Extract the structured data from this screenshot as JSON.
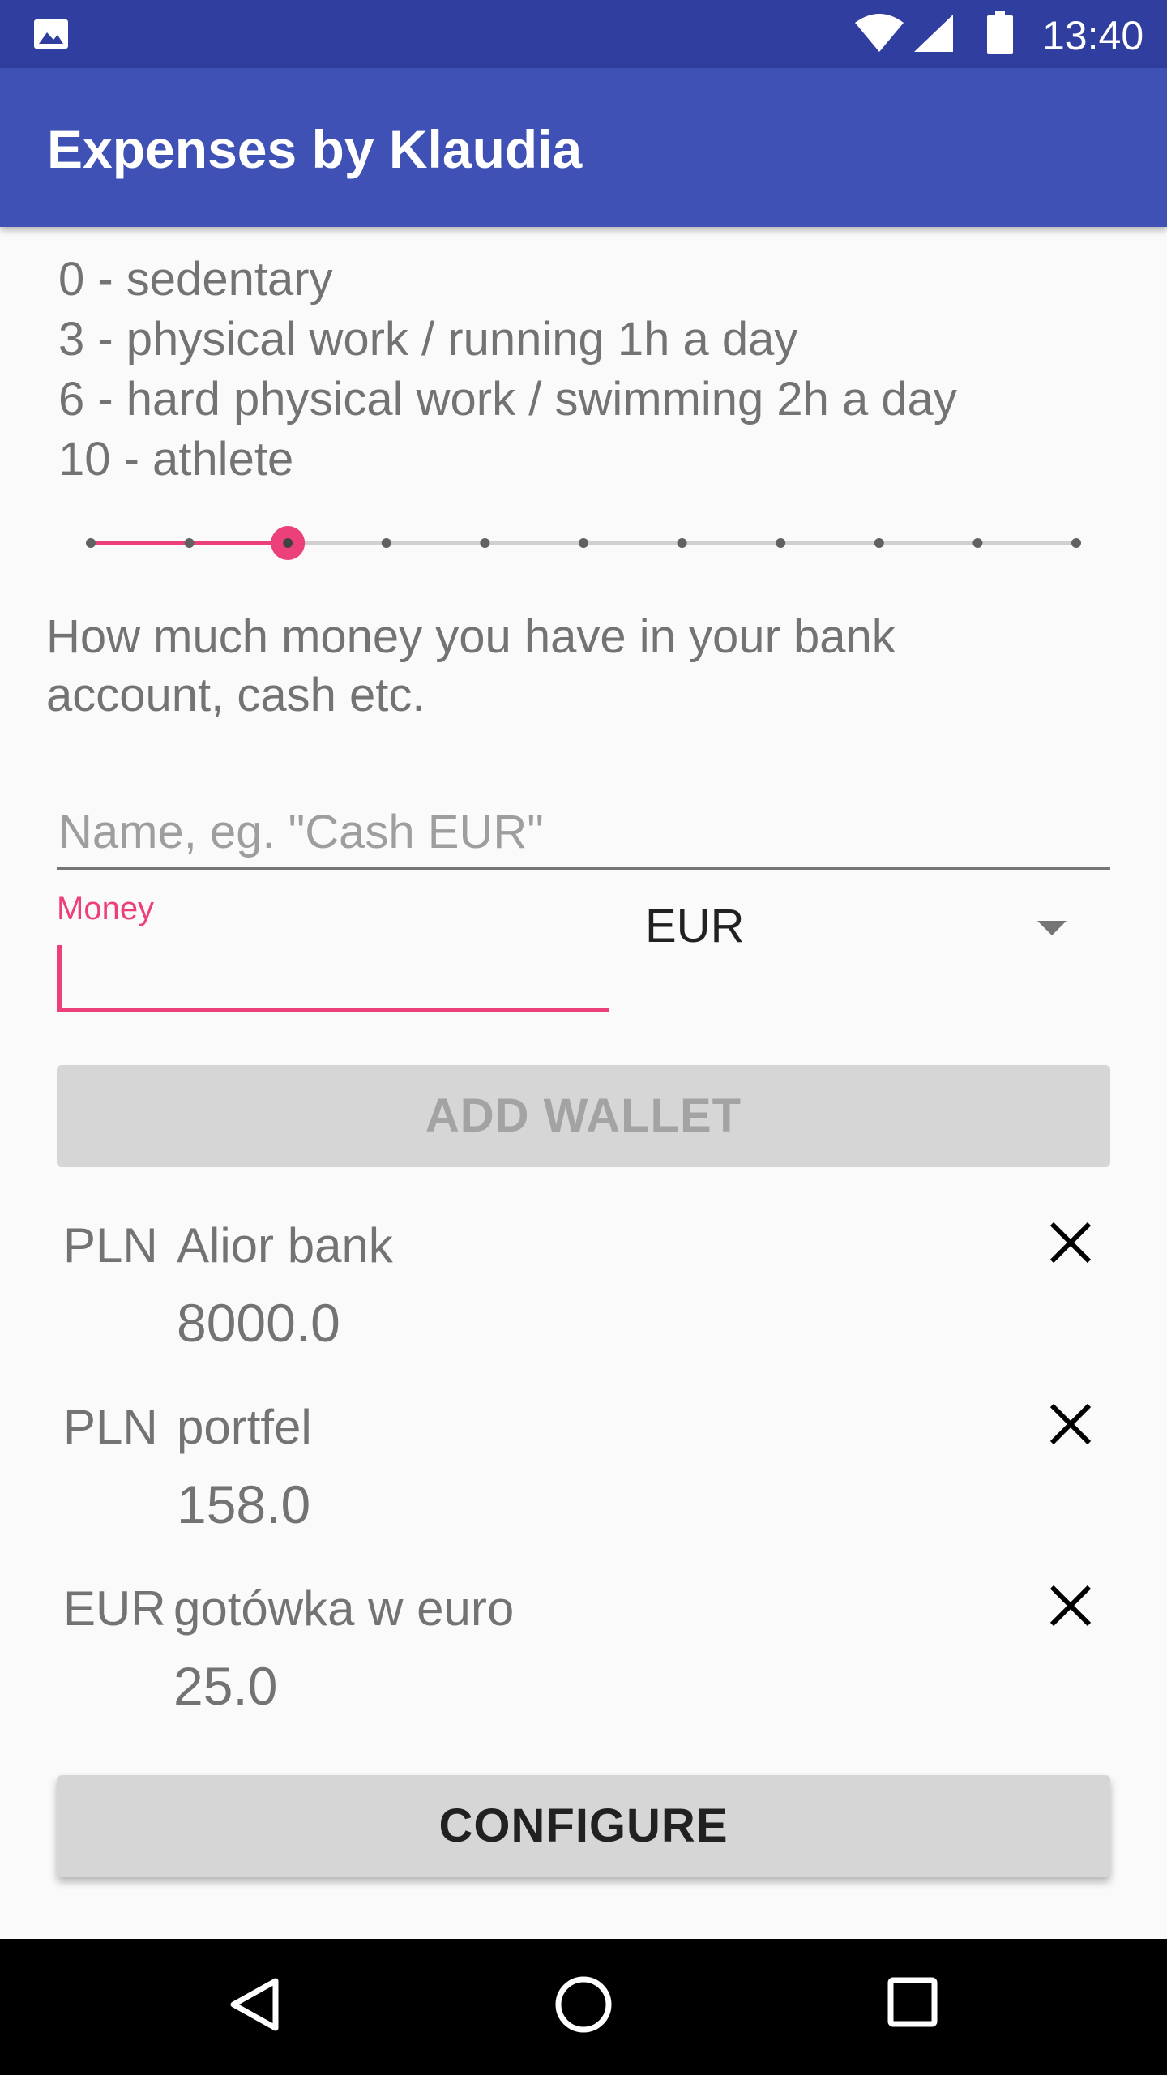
{
  "status_bar": {
    "time": "13:40",
    "icons": [
      "image-icon",
      "wifi-icon",
      "signal-icon",
      "battery-icon"
    ]
  },
  "app_bar": {
    "title": "Expenses by Klaudia"
  },
  "activity": {
    "scale_lines": [
      "0 - sedentary",
      "3 - physical work / running 1h a day",
      "6 - hard physical work / swimming 2h a day",
      "10 - athlete"
    ],
    "slider": {
      "min": 0,
      "max": 10,
      "value": 2
    }
  },
  "wallet_form": {
    "prompt": "How much money you have in your bank account, cash etc.",
    "name_placeholder": "Name, eg. \"Cash EUR\"",
    "money_label": "Money",
    "money_value": "",
    "currency": "EUR",
    "add_button_label": "ADD WALLET"
  },
  "wallets": [
    {
      "currency": "PLN",
      "name": "Alior bank",
      "amount": "8000.0"
    },
    {
      "currency": "PLN",
      "name": "portfel",
      "amount": "158.0"
    },
    {
      "currency": "EUR",
      "name": "gotówka w euro",
      "amount": "25.0"
    }
  ],
  "configure_button_label": "CONFIGURE",
  "colors": {
    "status_bar": "#303f9f",
    "app_bar": "#3f51b5",
    "accent": "#ec407a",
    "background": "#fafafa"
  },
  "nav_bar": {
    "icons": [
      "back-icon",
      "home-icon",
      "recents-icon"
    ]
  }
}
